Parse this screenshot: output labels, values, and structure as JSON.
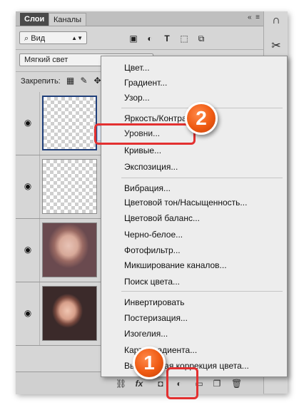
{
  "tabs": {
    "layers": "Слои",
    "channels": "Каналы"
  },
  "filter": {
    "kind": "Вид"
  },
  "blend_mode": "Мягкий свет",
  "lock_label": "Закрепить:",
  "menu_items": [
    "Цвет...",
    "Градиент...",
    "Узор...",
    "Яркость/Контраст...",
    "Уровни...",
    "Кривые...",
    "Экспозиция...",
    "Вибрация...",
    "Цветовой тон/Насыщенность...",
    "Цветовой баланс...",
    "Черно-белое...",
    "Фотофильтр...",
    "Микширование каналов...",
    "Поиск цвета...",
    "Инвертировать",
    "Постеризация...",
    "Изогелия...",
    "Карта градиента...",
    "Выборочная коррекция цвета..."
  ],
  "badges": {
    "one": "1",
    "two": "2"
  },
  "fx_label": "fx",
  "colors": {
    "callout": "#e33030",
    "badge": "#ef5a12",
    "highlight": "#dfe8f6"
  }
}
